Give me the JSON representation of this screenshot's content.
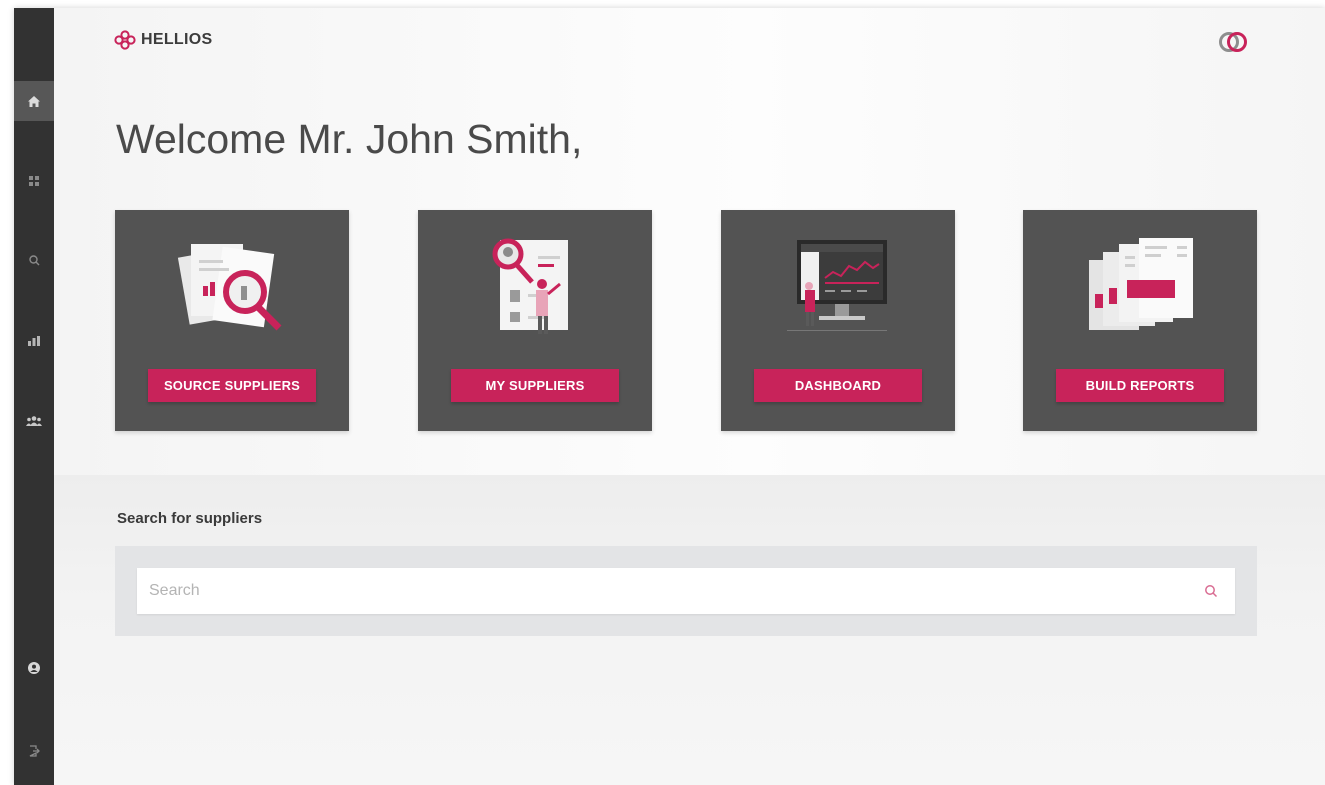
{
  "app": {
    "logo_text": "HELLIOS",
    "accent_color": "#c8235a",
    "brand_icon": "interlocking-rings-icon"
  },
  "sidebar": {
    "items": [
      {
        "icon": "home-icon",
        "active": true
      },
      {
        "icon": "grid-icon",
        "active": false
      },
      {
        "icon": "search-icon",
        "active": false
      },
      {
        "icon": "bar-chart-icon",
        "active": false
      },
      {
        "icon": "users-icon",
        "active": false
      },
      {
        "icon": "user-circle-icon",
        "active": false
      },
      {
        "icon": "logout-icon",
        "active": false
      }
    ]
  },
  "main": {
    "welcome": "Welcome Mr. John Smith,",
    "cards": [
      {
        "label": "SOURCE SUPPLIERS",
        "illustration": "documents-magnifier-illustration"
      },
      {
        "label": "MY SUPPLIERS",
        "illustration": "supplier-profile-illustration"
      },
      {
        "label": "DASHBOARD",
        "illustration": "monitor-dashboard-illustration"
      },
      {
        "label": "BUILD REPORTS",
        "illustration": "report-sheets-illustration"
      }
    ],
    "search": {
      "label": "Search for suppliers",
      "placeholder": "Search",
      "value": ""
    }
  }
}
